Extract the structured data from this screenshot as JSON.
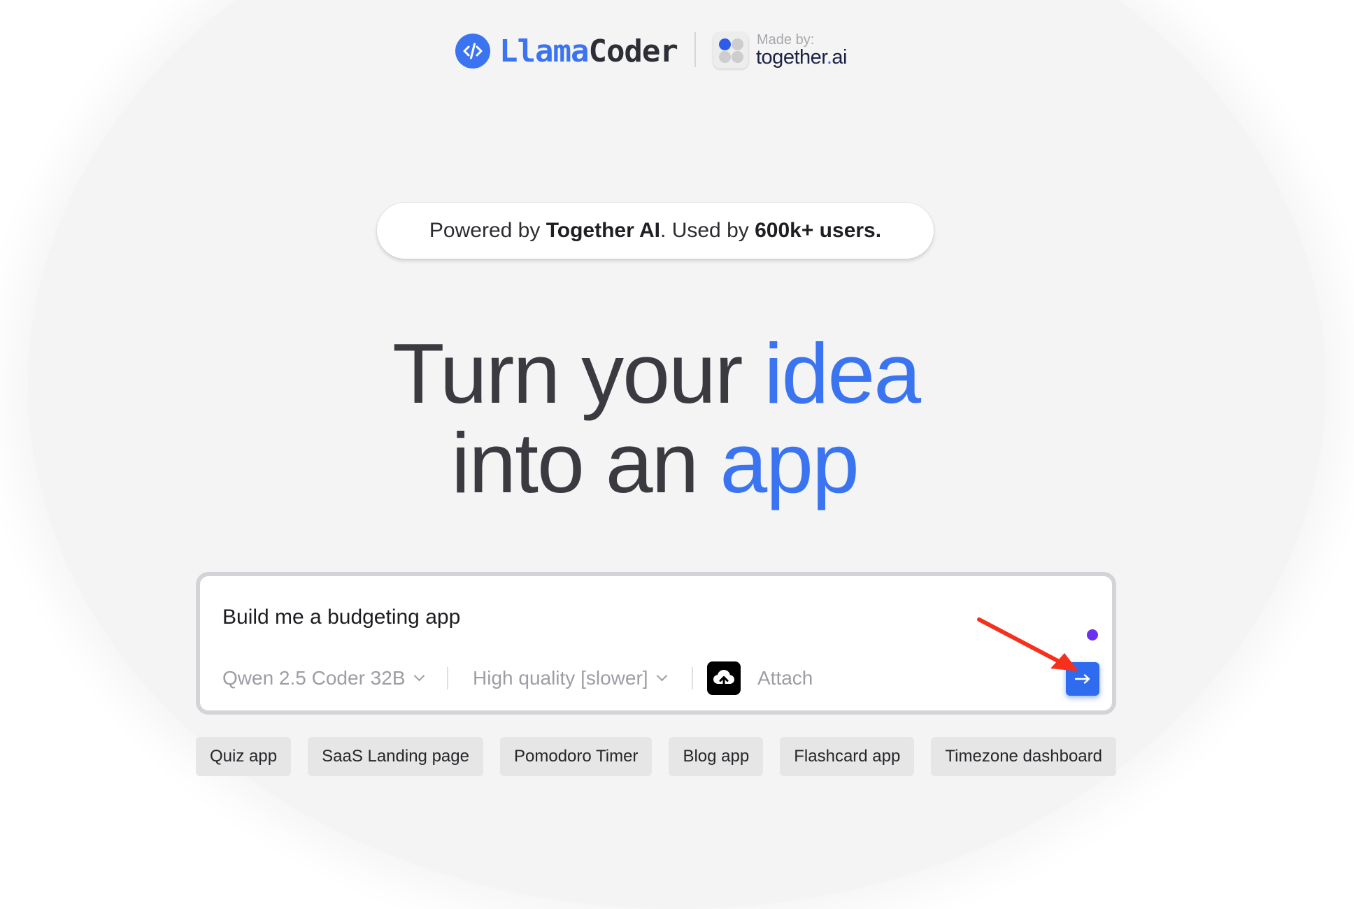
{
  "header": {
    "logo": {
      "part1": "Llama",
      "part2": "Coder",
      "icon": "code-icon"
    },
    "made_by_label": "Made by:",
    "brand": {
      "name": "together",
      "dot": ".",
      "suffix": "ai",
      "icon": "together-logo-icon"
    }
  },
  "banner": {
    "prefix": "Powered by ",
    "bold1": "Together AI",
    "middle": ". Used by ",
    "bold2": "600k+ users."
  },
  "headline": {
    "line1": "Turn your ",
    "line1_accent": "idea",
    "line2": "into an ",
    "line2_accent": "app"
  },
  "prompt": {
    "value": "Build me a budgeting app",
    "model": {
      "selected": "Qwen 2.5 Coder 32B",
      "icon": "chevron-down-icon"
    },
    "quality": {
      "selected": "High quality [slower]",
      "icon": "chevron-down-icon"
    },
    "attach": {
      "label": "Attach",
      "icon": "cloud-upload-icon"
    },
    "send": {
      "icon": "arrow-right-icon"
    }
  },
  "suggestions": [
    "Quiz app",
    "SaaS Landing page",
    "Pomodoro Timer",
    "Blog app",
    "Flashcard app",
    "Timezone dashboard"
  ],
  "colors": {
    "accent": "#3b74f0",
    "send_button": "#2f6bee",
    "status_dot": "#6a2ff0",
    "annotation_arrow": "#f5301d"
  }
}
